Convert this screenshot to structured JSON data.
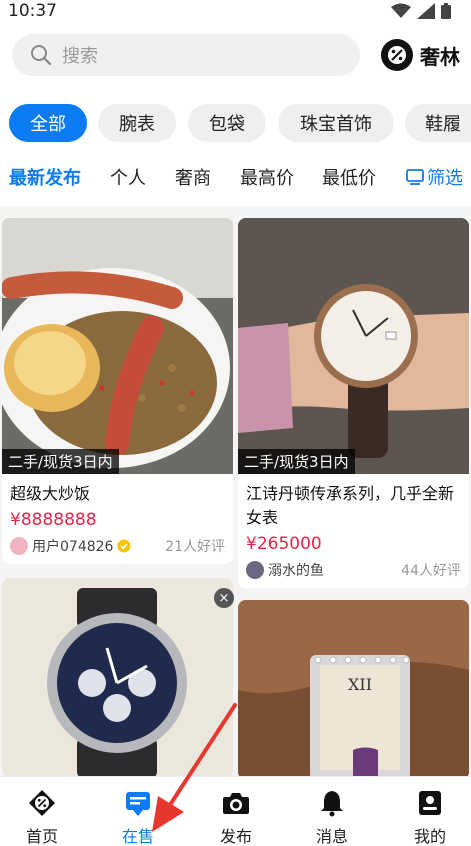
{
  "status": {
    "time": "10:37"
  },
  "header": {
    "search_placeholder": "搜索",
    "brand": "奢林"
  },
  "categories": [
    "全部",
    "腕表",
    "包袋",
    "珠宝首饰",
    "鞋履"
  ],
  "sorts": [
    "最新发布",
    "个人",
    "奢商",
    "最高价",
    "最低价"
  ],
  "filter_label": "筛选",
  "products": [
    {
      "tag": "二手/现货3日内",
      "title": "超级大炒饭",
      "price": "¥8888888",
      "seller": "用户074826",
      "reviews": "21人好评"
    },
    {
      "tag": "二手/现货3日内",
      "title": "江诗丹顿传承系列，几乎全新女表",
      "price": "¥265000",
      "seller": "溺水的鱼",
      "reviews": "44人好评"
    }
  ],
  "close_symbol": "×",
  "tabs": [
    {
      "label": "首页",
      "icon": "home-icon"
    },
    {
      "label": "在售",
      "icon": "on-sale-icon"
    },
    {
      "label": "发布",
      "icon": "camera-icon"
    },
    {
      "label": "消息",
      "icon": "bell-icon"
    },
    {
      "label": "我的",
      "icon": "profile-icon"
    }
  ],
  "colors": {
    "accent": "#0d7cf2",
    "price": "#e4264a",
    "annotation": "#e8372f"
  }
}
